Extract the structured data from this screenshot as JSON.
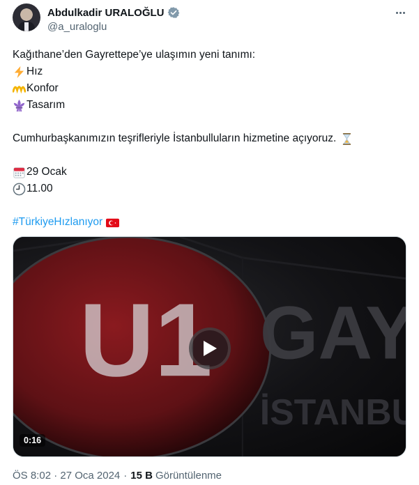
{
  "author": {
    "display_name": "Abdulkadir URALOĞLU",
    "handle": "@a_uraloglu"
  },
  "icons": {
    "verified": "verified-badge-icon",
    "more": "more-horizontal-icon",
    "play": "play-icon"
  },
  "tweet": {
    "line1": "Kağıthane’den Gayrettepe’ye ulaşımın yeni tanımı:",
    "item1": "Hız",
    "item2": "Konfor",
    "item3": "Tasarım",
    "announcement": "Cumhurbaşkanımızın teşrifleriyle İstanbulluların hizmetine açıyoruz.",
    "date": "29 Ocak",
    "time": "11.00",
    "hashtag": "#TürkiyeHızlanıyor"
  },
  "media": {
    "duration": "0:16",
    "sign_code": "U1",
    "sign_text_1": "GAY",
    "sign_text_2": "İSTANBU"
  },
  "meta": {
    "timestamp": "ÖS 8:02 · 27 Oca 2024",
    "separator": "·",
    "views_count": "15 B",
    "views_label": "Görüntülenme"
  },
  "colors": {
    "text": "#0f1419",
    "muted": "#536471",
    "link": "#1d9bf0",
    "verified": "#829aab",
    "sign_red": "#7a1418"
  }
}
